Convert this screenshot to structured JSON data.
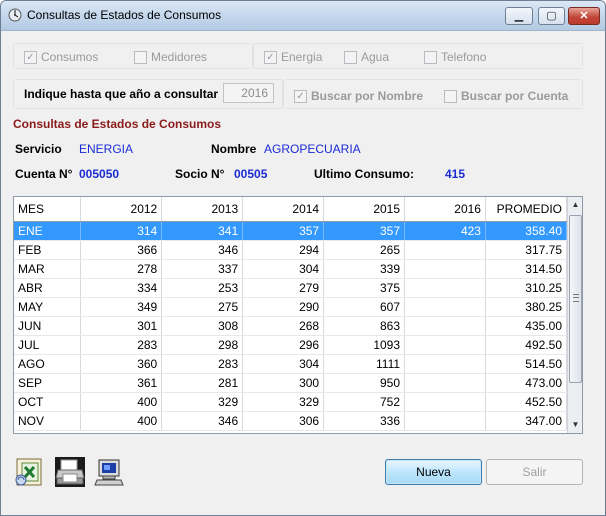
{
  "window": {
    "title": "Consultas de Estados de Consumos",
    "minimize_glyph": "▁",
    "maximize_glyph": "▢",
    "close_glyph": "✕"
  },
  "filters": {
    "services": [
      {
        "label": "Consumos",
        "checked": true
      },
      {
        "label": "Medidores",
        "checked": false
      },
      {
        "label": "Energia",
        "checked": true
      },
      {
        "label": "Agua",
        "checked": false
      },
      {
        "label": "Telefono",
        "checked": false
      }
    ],
    "year_label": "Indique hasta que año a consultar",
    "year_value": "2016",
    "search": [
      {
        "label": "Buscar por Nombre",
        "checked": true
      },
      {
        "label": "Buscar por Cuenta",
        "checked": false
      }
    ]
  },
  "section_title": "Consultas de Estados de Consumos",
  "info": {
    "servicio_label": "Servicio",
    "servicio_value": "ENERGIA",
    "nombre_label": "Nombre",
    "nombre_value": "AGROPECUARIA",
    "cuenta_label": "Cuenta N°",
    "cuenta_value": "005050",
    "socio_label": "Socio N°",
    "socio_value": "00505",
    "ultimo_label": "Ultimo Consumo:",
    "ultimo_value": "415"
  },
  "table": {
    "columns": [
      "MES",
      "2012",
      "2013",
      "2014",
      "2015",
      "2016",
      "PROMEDIO"
    ],
    "rows": [
      [
        "ENE",
        "314",
        "341",
        "357",
        "357",
        "423",
        "358.40"
      ],
      [
        "FEB",
        "366",
        "346",
        "294",
        "265",
        "",
        "317.75"
      ],
      [
        "MAR",
        "278",
        "337",
        "304",
        "339",
        "",
        "314.50"
      ],
      [
        "ABR",
        "334",
        "253",
        "279",
        "375",
        "",
        "310.25"
      ],
      [
        "MAY",
        "349",
        "275",
        "290",
        "607",
        "",
        "380.25"
      ],
      [
        "JUN",
        "301",
        "308",
        "268",
        "863",
        "",
        "435.00"
      ],
      [
        "JUL",
        "283",
        "298",
        "296",
        "1093",
        "",
        "492.50"
      ],
      [
        "AGO",
        "360",
        "283",
        "304",
        "1111",
        "",
        "514.50"
      ],
      [
        "SEP",
        "361",
        "281",
        "300",
        "950",
        "",
        "473.00"
      ],
      [
        "OCT",
        "400",
        "329",
        "329",
        "752",
        "",
        "452.50"
      ],
      [
        "NOV",
        "400",
        "346",
        "306",
        "336",
        "",
        "347.00"
      ]
    ],
    "selected_row": "ENE"
  },
  "buttons": {
    "nueva": "Nueva",
    "salir": "Salir"
  },
  "toolbar_icons": [
    "excel-export-icon",
    "printer-icon",
    "computer-icon"
  ],
  "colors": {
    "section_title": "#8b1a1a",
    "value_blue": "#1a2bd4",
    "selection": "#3399ff"
  }
}
